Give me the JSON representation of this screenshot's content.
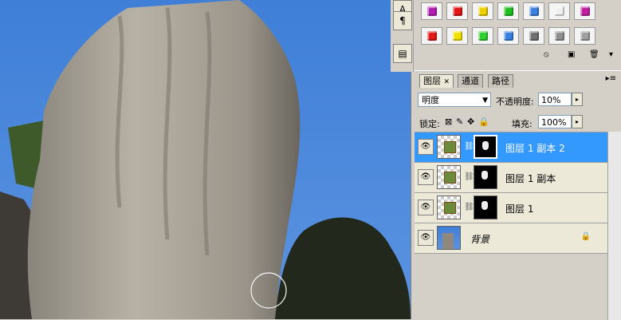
{
  "dock": {
    "icons": [
      "type-tool-icon",
      "paragraph-icon",
      "notes-icon"
    ],
    "glyphs": [
      "A",
      "¶",
      "▤"
    ]
  },
  "swatches": {
    "row1": [
      "#b01fb0",
      "#e01818",
      "#f0d000",
      "#20c020",
      "#3a80e0",
      "#f0f0f0",
      "#c020a0"
    ],
    "row2": [
      "#e01818",
      "#f0e000",
      "#30d030",
      "#3a80e0",
      "#707070",
      "#909090",
      "#a0a0a0"
    ]
  },
  "layers_panel": {
    "tabs": [
      "图层",
      "通道",
      "路径"
    ],
    "blend_mode": "明度",
    "opacity_label": "不透明度:",
    "opacity_value": "10%",
    "lock_label": "锁定:",
    "fill_label": "填充:",
    "fill_value": "100%",
    "layers": [
      {
        "name": "图层 1 副本 2",
        "selected": true
      },
      {
        "name": "图层 1 副本",
        "selected": false
      },
      {
        "name": "图层 1",
        "selected": false
      },
      {
        "name": "背景",
        "selected": false,
        "locked": true
      }
    ]
  }
}
